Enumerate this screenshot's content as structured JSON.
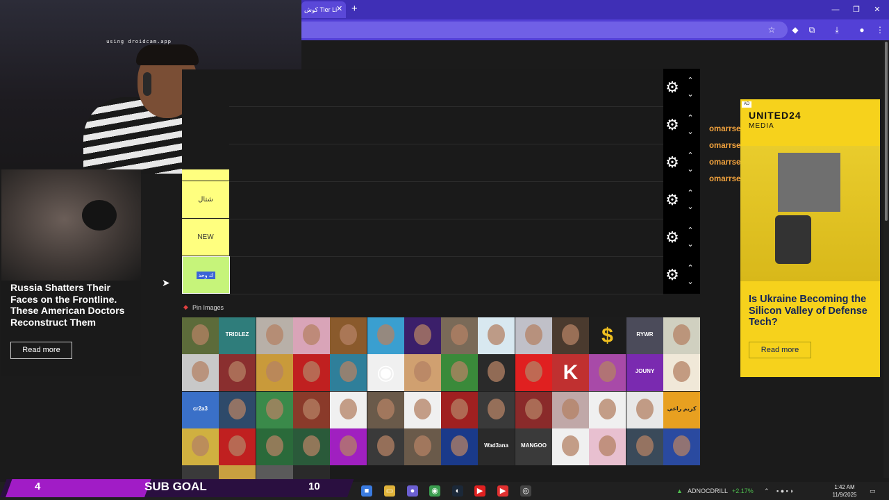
{
  "browser": {
    "tab_title": "كوش Tier Li",
    "tab_close": "✕",
    "new_tab": "+",
    "win_min": "—",
    "win_max": "❐",
    "win_close": "✕"
  },
  "webcam": {
    "overlay_text": "using droidcam.app"
  },
  "ad_left": {
    "headline": "Russia Shatters Their Faces on the Frontline. These American Doctors Reconstruct Them",
    "button": "Read more"
  },
  "tiers": [
    {
      "label": "شتال"
    },
    {
      "label": "NEW"
    },
    {
      "label": "ك وخد"
    }
  ],
  "tier_controls": {
    "gear": "⚙",
    "up": "⌃",
    "down": "⌄"
  },
  "pin": {
    "icon": "📌",
    "label": "Pin Images"
  },
  "tiles": {
    "texts": [
      "TRIDLEZ",
      "RYWR",
      "JOUNY",
      "cr2a3",
      "كريم راعي",
      "Wad3ana",
      "MANGOO"
    ]
  },
  "chat": [
    {
      "user": "omarrsellimm :"
    },
    {
      "user": "omarrsellimm :"
    },
    {
      "user": "omarrsellimm :"
    },
    {
      "user": "omarrsellimm :"
    }
  ],
  "ad_right": {
    "badge": "AD",
    "logo": "UNITED24",
    "media": "MEDIA",
    "headline": "Is Ukraine Becoming the Silicon Valley of Defense Tech?",
    "button": "Read more"
  },
  "sub_goal": {
    "current": "4",
    "label": "SUB GOAL",
    "target": "10",
    "progress": 0.4
  },
  "taskbar": {
    "stock_name": "ADNOCDRILL",
    "stock_change": "+2.17%",
    "time": "1:42 AM",
    "date": "11/9/2025"
  },
  "colors": {
    "tier_yellow": "#ffff7f",
    "tier_green": "#c6f47a",
    "chrome_purple": "#3f2fb6",
    "ad_yellow": "#f6d21c",
    "chat_orange": "#f3a33d",
    "subgoal_purple": "#a11cc6"
  }
}
